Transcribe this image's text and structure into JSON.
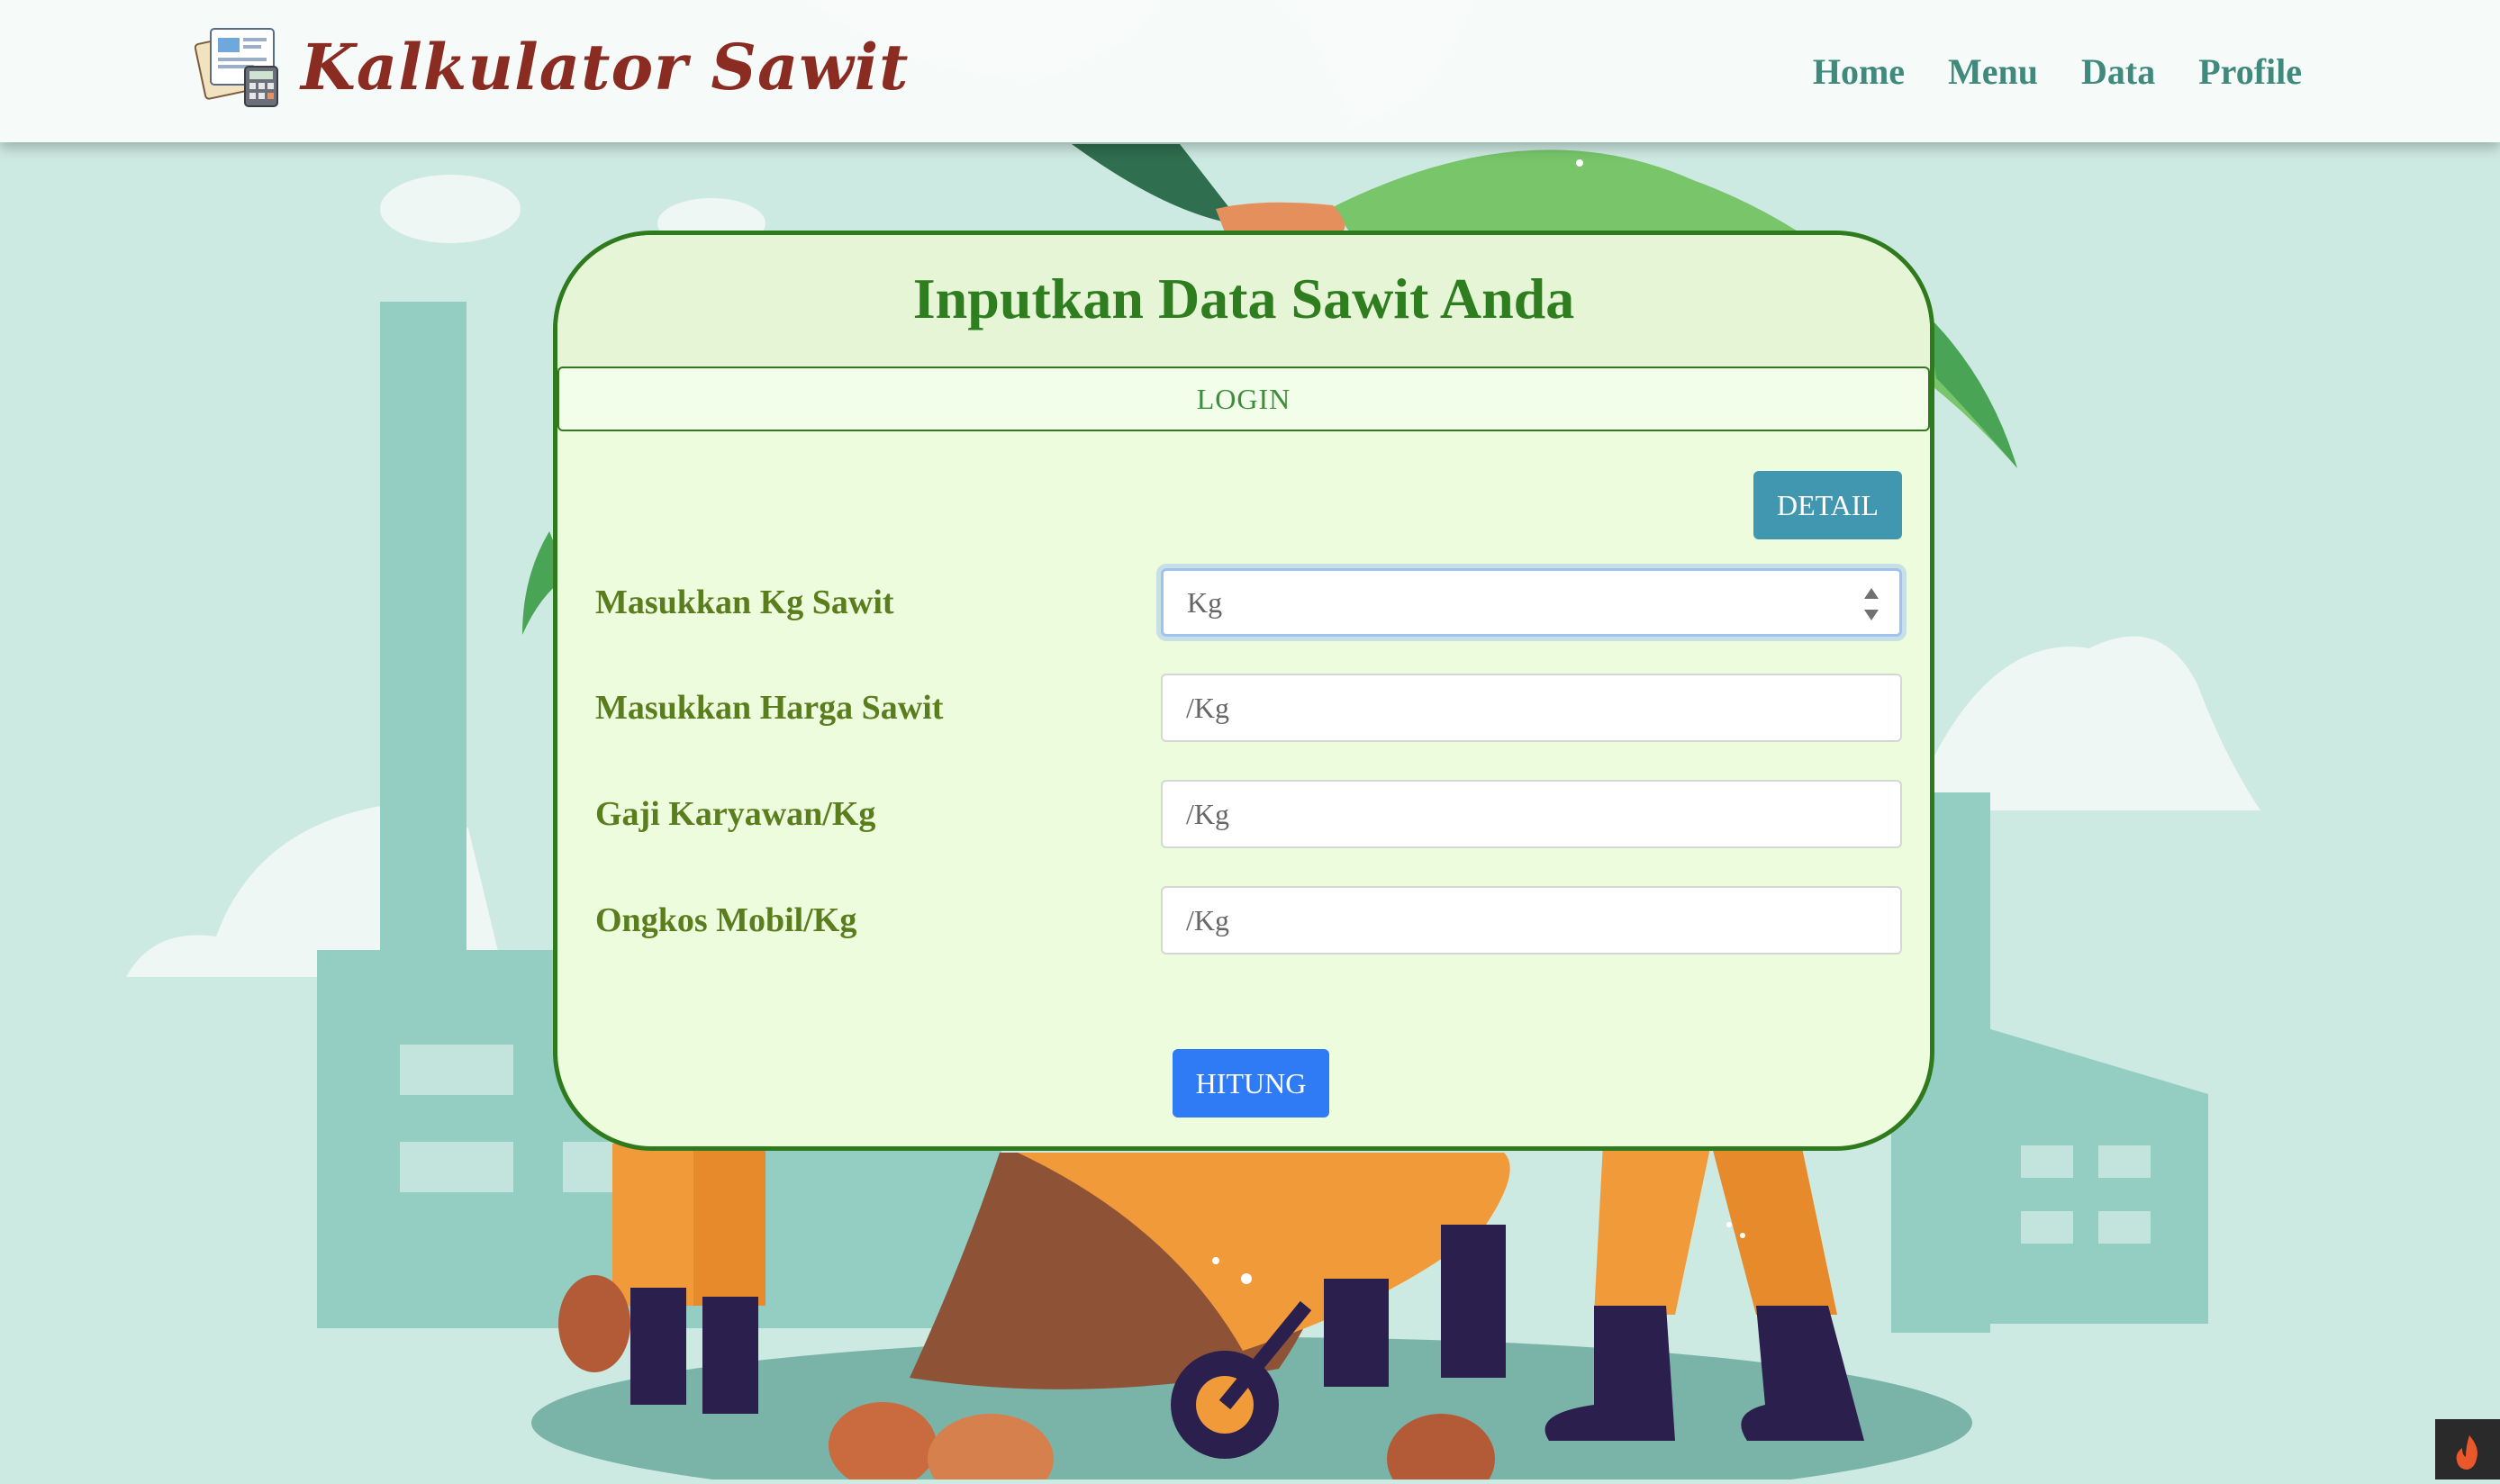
{
  "brand": {
    "name": "Kalkulator Sawit",
    "logo_icon": "calculator-report-icon"
  },
  "nav": {
    "items": [
      {
        "label": "Home"
      },
      {
        "label": "Menu"
      },
      {
        "label": "Data"
      },
      {
        "label": "Profile"
      }
    ]
  },
  "card": {
    "title": "Inputkan Data Sawit Anda",
    "login_label": "LOGIN",
    "detail_label": "DETAIL",
    "fields": [
      {
        "label": "Masukkan Kg Sawit",
        "placeholder": "Kg",
        "type": "number",
        "focused": true
      },
      {
        "label": "Masukkan Harga Sawit",
        "placeholder": "/Kg"
      },
      {
        "label": "Gaji Karyawan/Kg",
        "placeholder": "/Kg"
      },
      {
        "label": "Ongkos Mobil/Kg",
        "placeholder": "/Kg"
      }
    ],
    "submit_label": "HITUNG"
  },
  "corner_icon": "flame-icon",
  "colors": {
    "brand": "#8b2c22",
    "nav_link": "#3f8a7c",
    "card_border": "#2f7a1c",
    "title": "#2e7d1f",
    "label": "#5a7d1e",
    "detail_button": "#4197b0",
    "submit_button": "#2f7bf5",
    "background": "#cdeae2"
  }
}
